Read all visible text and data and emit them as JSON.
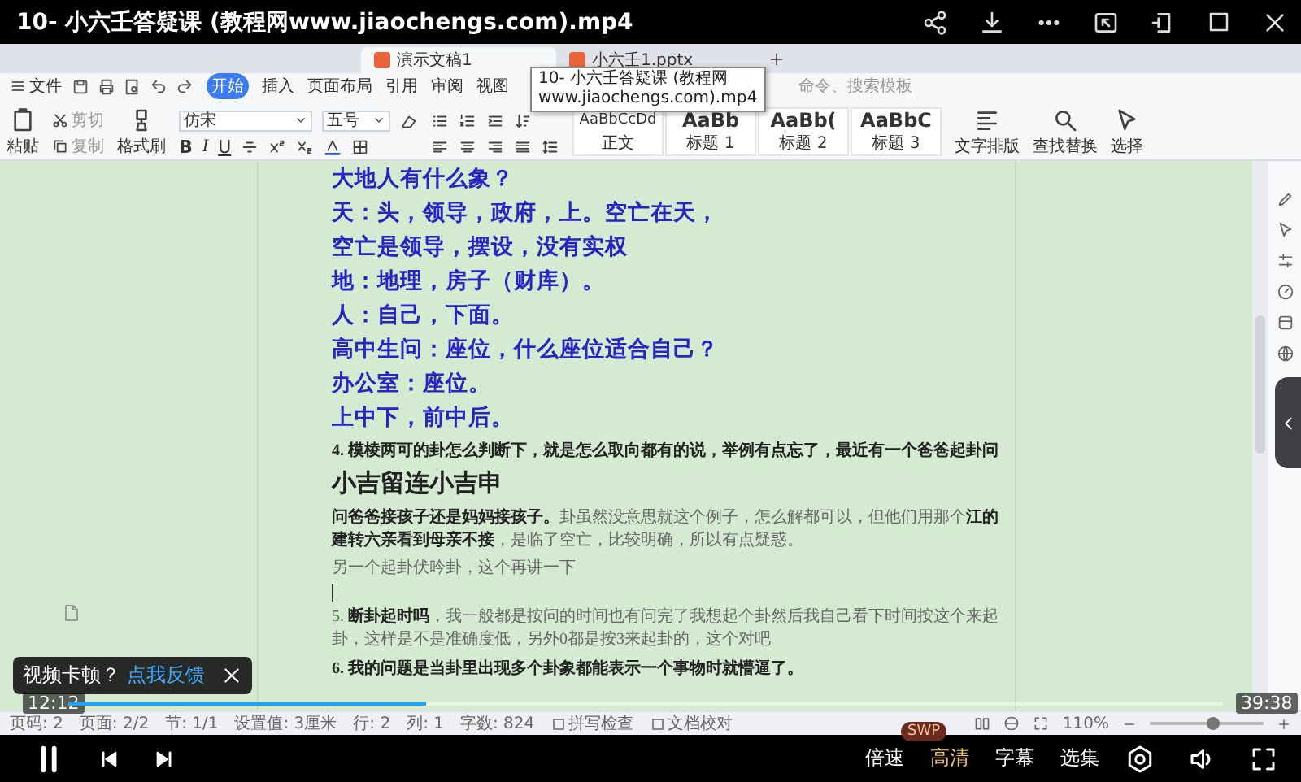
{
  "player": {
    "title": "10- 小六壬答疑课 (教程网www.jiaochengs.com).mp4"
  },
  "app": {
    "doc_tabs": [
      {
        "label": "演示文稿1",
        "selected": true
      },
      {
        "label": "小六壬1.pptx",
        "selected": false
      }
    ],
    "tooltip": [
      "10- 小六壬答疑课 (教程网",
      "www.jiaochengs.com).mp4"
    ],
    "file_menu": "文件",
    "ribbon_tabs": [
      {
        "label": "开始",
        "selected": true
      },
      {
        "label": "插入",
        "selected": false
      },
      {
        "label": "页面布局",
        "selected": false
      },
      {
        "label": "引用",
        "selected": false
      },
      {
        "label": "审阅",
        "selected": false
      },
      {
        "label": "视图",
        "selected": false
      }
    ],
    "search": {
      "placeholder": "命令、搜索模板"
    },
    "ribbon": {
      "paste": "粘贴",
      "cut": "剪切",
      "copy": "复制",
      "format_painter": "格式刷",
      "font": "仿宋",
      "font_size": "五号",
      "format_buttons": [
        "B",
        "I",
        "U"
      ],
      "styles": [
        {
          "preview": "AaBbCcDd",
          "label": "正文"
        },
        {
          "preview": "AaBb",
          "label": "标题 1"
        },
        {
          "preview": "AaBb(",
          "label": "标题 2"
        },
        {
          "preview": "AaBbC",
          "label": "标题 3"
        }
      ],
      "tools": [
        {
          "kind": "layout",
          "label": "文字排版"
        },
        {
          "kind": "find",
          "label": "查找替换"
        },
        {
          "kind": "select",
          "label": "选择"
        }
      ]
    }
  },
  "document": {
    "paragraphs": [
      {
        "kind": "blue",
        "text": "大地人有什么象？"
      },
      {
        "kind": "blue",
        "text": "天：头，领导，政府，上。空亡在天，"
      },
      {
        "kind": "blue",
        "text": "空亡是领导，摆设，没有实权"
      },
      {
        "kind": "blue",
        "text": "地：地理，房子（财库）。"
      },
      {
        "kind": "blue",
        "text": "人：自己，下面。"
      },
      {
        "kind": "blue",
        "text": "高中生问：座位，什么座位适合自己？"
      },
      {
        "kind": "blue",
        "text": "办公室：座位。"
      },
      {
        "kind": "blue",
        "text": "上中下，前中后。"
      },
      {
        "kind": "question",
        "text": "4. 模棱两可的卦怎么判断下，就是怎么取向都有的说，举例有点忘了，最近有一个爸爸起卦问"
      },
      {
        "kind": "heading",
        "text": "小吉留连小吉申"
      },
      {
        "kind": "body",
        "text": "**问爸爸接孩子还是妈妈接孩子。**卦虽然没意思就这个例子，怎么解都可以，但他们用那个**江的建转六亲看到母亲不接**，是临了空亡，比较明确，所以有点疑惑。"
      },
      {
        "kind": "body",
        "text": "另一个起卦伏吟卦，这个再讲一下"
      },
      {
        "kind": "cursor"
      },
      {
        "kind": "body",
        "text": "5. **断卦起时吗**，我一般都是按问的时间也有问完了我想起个卦然后我自己看下时间按这个来起卦，这样是不是准确度低，另外0都是按3来起卦的，这个对吧"
      },
      {
        "kind": "question",
        "text": "6. 我的问题是当卦里出现多个卦象都能表示一个事物时就懵逼了。"
      }
    ]
  },
  "status_bar": {
    "items": [
      "页码: 2",
      "页面: 2/2",
      "节: 1/1",
      "设置值: 3厘米",
      "行: 2",
      "列: 1",
      "字数: 824"
    ],
    "buttons": [
      "拼写检查",
      "文档校对"
    ],
    "zoom": "110%",
    "zoom_slider": {
      "level": 0.55
    }
  },
  "player_controls": {
    "toast": {
      "text": "视频卡顿？",
      "link": "点我反馈"
    },
    "current_time": "12:12",
    "total_time": "39:38",
    "level": 0.31,
    "badge": "SWP",
    "options": [
      {
        "label": "倍速",
        "selected": false
      },
      {
        "label": "高清",
        "selected": true
      },
      {
        "label": "字幕",
        "selected": false
      },
      {
        "label": "选集",
        "selected": false
      }
    ]
  }
}
